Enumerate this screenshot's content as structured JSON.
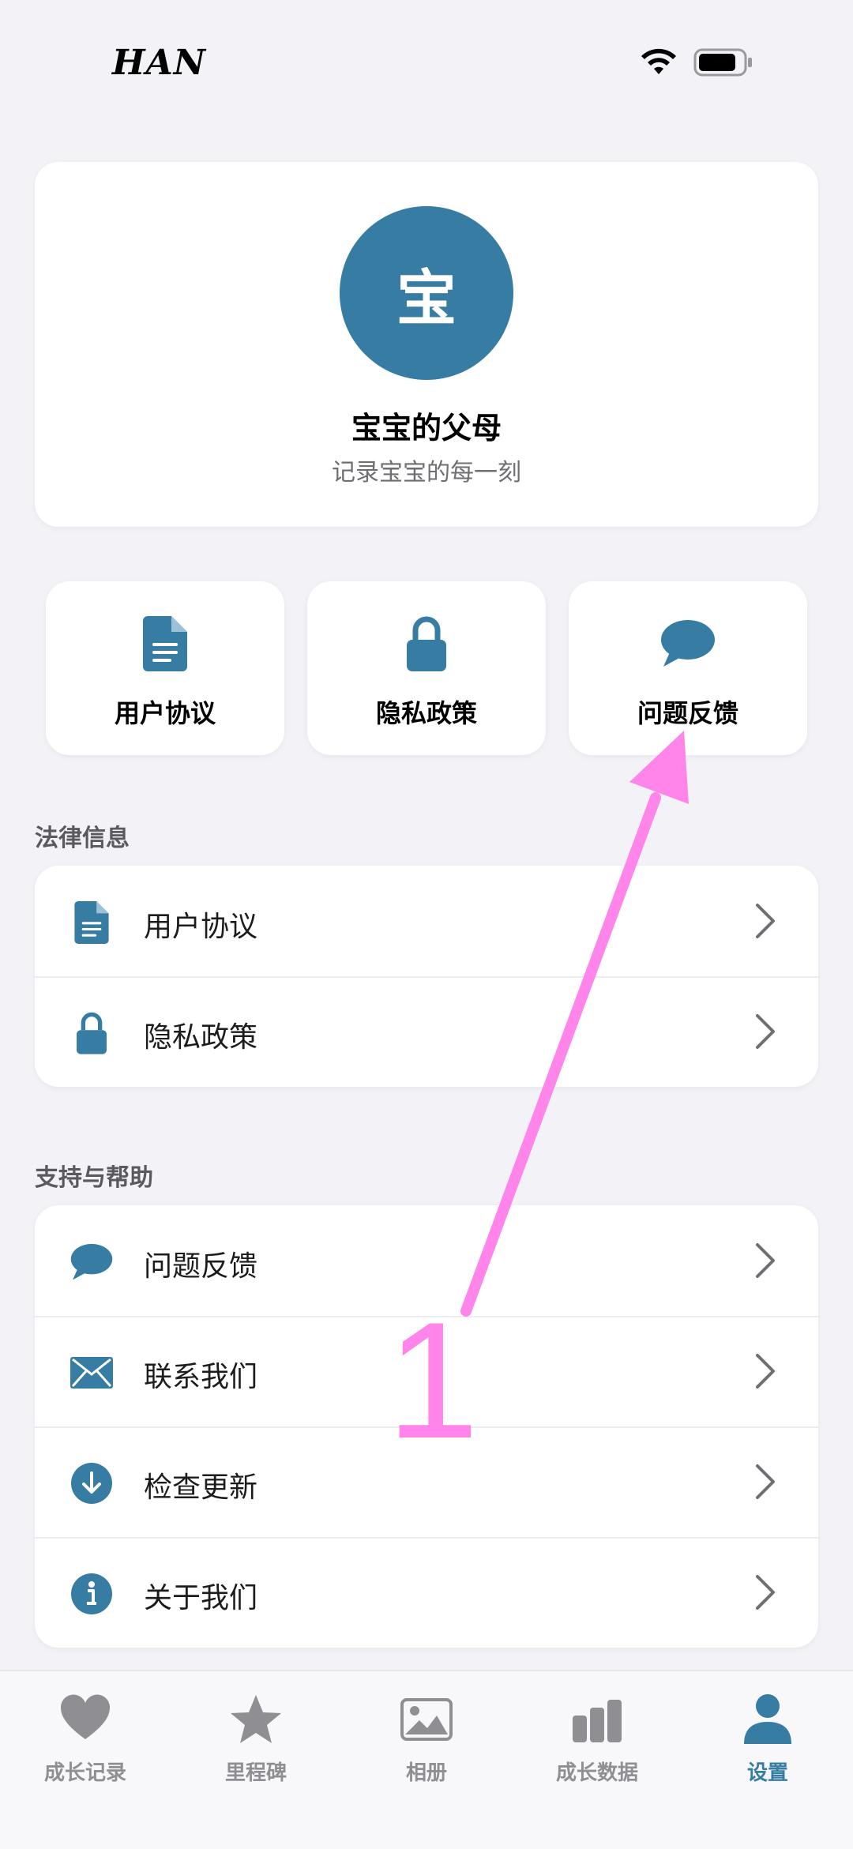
{
  "status_bar": {
    "carrier": "HAN"
  },
  "profile": {
    "avatar_text": "宝",
    "name": "宝宝的父母",
    "subtitle": "记录宝宝的每一刻",
    "avatar_color": "#377ca3"
  },
  "quick_actions": [
    {
      "label": "用户协议",
      "icon": "document-icon"
    },
    {
      "label": "隐私政策",
      "icon": "lock-icon"
    },
    {
      "label": "问题反馈",
      "icon": "chat-bubble-icon"
    }
  ],
  "sections": {
    "legal": {
      "title": "法律信息",
      "items": [
        {
          "label": "用户协议",
          "icon": "document-icon"
        },
        {
          "label": "隐私政策",
          "icon": "lock-icon"
        }
      ]
    },
    "support": {
      "title": "支持与帮助",
      "items": [
        {
          "label": "问题反馈",
          "icon": "chat-bubble-icon"
        },
        {
          "label": "联系我们",
          "icon": "envelope-icon"
        },
        {
          "label": "检查更新",
          "icon": "download-icon"
        },
        {
          "label": "关于我们",
          "icon": "info-icon"
        }
      ]
    }
  },
  "annotation": {
    "number": "1",
    "color": "#ff85ea"
  },
  "tab_bar": {
    "items": [
      {
        "label": "成长记录",
        "icon": "heart-icon",
        "active": false
      },
      {
        "label": "里程碑",
        "icon": "star-icon",
        "active": false
      },
      {
        "label": "相册",
        "icon": "photo-icon",
        "active": false
      },
      {
        "label": "成长数据",
        "icon": "bar-chart-icon",
        "active": false
      },
      {
        "label": "设置",
        "icon": "person-icon",
        "active": true
      }
    ],
    "active_color": "#377ca3",
    "inactive_color": "#8e8e93"
  }
}
